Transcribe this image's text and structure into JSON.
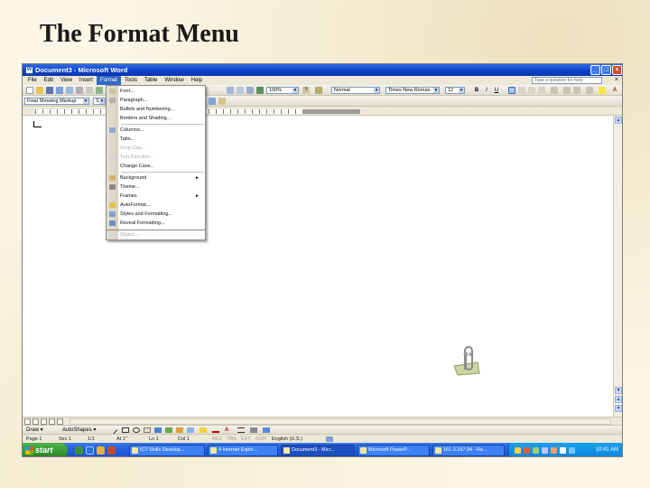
{
  "slide": {
    "title": "The Format Menu"
  },
  "window": {
    "title": "Document3 - Microsoft Word"
  },
  "menubar": {
    "items": [
      "File",
      "Edit",
      "View",
      "Insert",
      "Format",
      "Tools",
      "Table",
      "Window",
      "Help"
    ],
    "help_placeholder": "Type a question for help",
    "close_glyph": "×"
  },
  "toolbar": {
    "zoom": "100%",
    "style": "Normal",
    "font": "Times New Roman",
    "size": "12",
    "markup": "Final Showing Markup",
    "show": "Show",
    "bold": "B",
    "italic": "I",
    "underline": "U"
  },
  "format_menu": {
    "items": [
      {
        "label": "Font...",
        "disabled": false,
        "submenu": false
      },
      {
        "label": "Paragraph...",
        "disabled": false,
        "submenu": false
      },
      {
        "label": "Bullets and Numbering...",
        "disabled": false,
        "submenu": false
      },
      {
        "label": "Borders and Shading...",
        "disabled": false,
        "submenu": false
      },
      {
        "label": "Columns...",
        "disabled": false,
        "submenu": false
      },
      {
        "label": "Tabs...",
        "disabled": false,
        "submenu": false
      },
      {
        "label": "Drop Cap...",
        "disabled": true,
        "submenu": false
      },
      {
        "label": "Text Direction...",
        "disabled": true,
        "submenu": false
      },
      {
        "label": "Change Case...",
        "disabled": false,
        "submenu": false
      },
      {
        "label": "Background",
        "disabled": false,
        "submenu": true
      },
      {
        "label": "Theme...",
        "disabled": false,
        "submenu": false
      },
      {
        "label": "Frames",
        "disabled": false,
        "submenu": true
      },
      {
        "label": "AutoFormat...",
        "disabled": false,
        "submenu": false
      },
      {
        "label": "Styles and Formatting...",
        "disabled": false,
        "submenu": false
      },
      {
        "label": "Reveal Formatting...",
        "disabled": false,
        "submenu": false
      },
      {
        "label": "Object...",
        "disabled": true,
        "submenu": false
      }
    ]
  },
  "drawbar": {
    "draw": "Draw ▾",
    "autoshapes": "AutoShapes ▾"
  },
  "status": {
    "page": "Page 1",
    "sec": "Sec 1",
    "pages": "1/1",
    "at": "At 1\"",
    "ln": "Ln 1",
    "col": "Col 1",
    "rec": "REC",
    "trk": "TRK",
    "ext": "EXT",
    "ovr": "OVR",
    "lang": "English (U.S.)"
  },
  "taskbar": {
    "start": "start",
    "tasks": [
      "ICT Skills Develop...",
      "4 Internet Explo...",
      "Document3 - Micr...",
      "Microsoft PowerP...",
      "161.2.157.94 - Re..."
    ],
    "clock": "10:41 AM"
  },
  "colors": {
    "titlebar": "#0a40c8",
    "menu_highlight": "#316ac5",
    "taskbar": "#245edb",
    "start": "#379a33"
  }
}
